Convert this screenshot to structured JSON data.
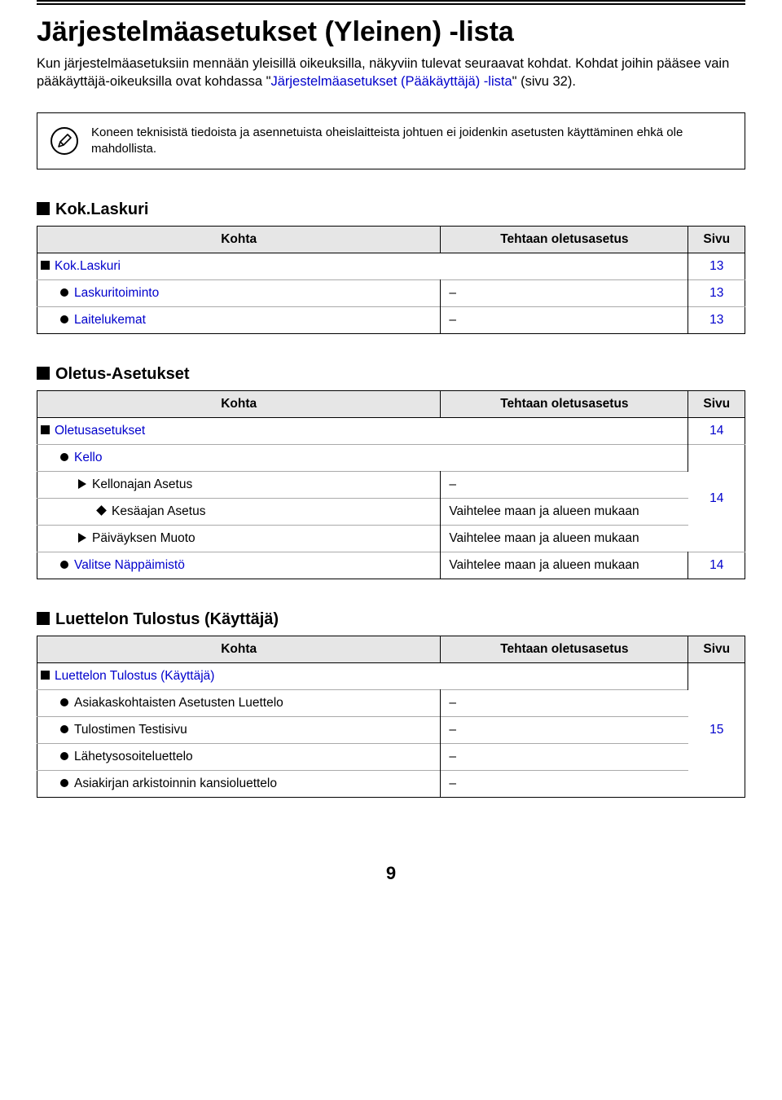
{
  "page": {
    "title": "Järjestelmäasetukset (Yleinen) -lista",
    "intro_part1": "Kun järjestelmäasetuksiin mennään yleisillä oikeuksilla, näkyviin tulevat seuraavat kohdat. Kohdat joihin pääsee vain pääkäyttäjä-oikeuksilla ovat kohdassa \"",
    "intro_link": "Järjestelmäasetukset (Pääkäyttäjä) -lista",
    "intro_part2": "\" (sivu 32).",
    "note_icon_glyph": "✎",
    "note_text": "Koneen teknisistä tiedoista ja asennetuista oheislaitteista johtuen ei joidenkin asetusten käyttäminen ehkä ole mahdollista.",
    "page_number": "9"
  },
  "headers": {
    "item": "Kohta",
    "default": "Tehtaan oletusasetus",
    "page": "Sivu"
  },
  "sections": {
    "kok": {
      "heading": "Kok.Laskuri",
      "rows": {
        "r0_label": "Kok.Laskuri",
        "r0_page": "13",
        "r1_label": "Laskuritoiminto",
        "r1_default": "–",
        "r1_page": "13",
        "r2_label": "Laitelukemat",
        "r2_default": "–",
        "r2_page": "13"
      }
    },
    "oletus": {
      "heading": "Oletus-Asetukset",
      "rows": {
        "r0_label": "Oletusasetukset",
        "r0_page": "14",
        "r1_label": "Kello",
        "r2_label": "Kellonajan Asetus",
        "r2_default": "–",
        "r_group_page": "14",
        "r3_label": "Kesäajan Asetus",
        "r3_default": "Vaihtelee maan ja alueen mukaan",
        "r4_label": "Päiväyksen Muoto",
        "r4_default": "Vaihtelee maan ja alueen mukaan",
        "r5_label": "Valitse Näppäimistö",
        "r5_default": "Vaihtelee maan ja alueen mukaan",
        "r5_page": "14"
      }
    },
    "luettelo": {
      "heading": "Luettelon Tulostus (Käyttäjä)",
      "rows": {
        "r0_label": "Luettelon Tulostus (Käyttäjä)",
        "r_group_page": "15",
        "r1_label": "Asiakaskohtaisten Asetusten Luettelo",
        "r1_default": "–",
        "r2_label": "Tulostimen Testisivu",
        "r2_default": "–",
        "r3_label": "Lähetysosoiteluettelo",
        "r3_default": "–",
        "r4_label": "Asiakirjan arkistoinnin kansioluettelo",
        "r4_default": "–"
      }
    }
  }
}
